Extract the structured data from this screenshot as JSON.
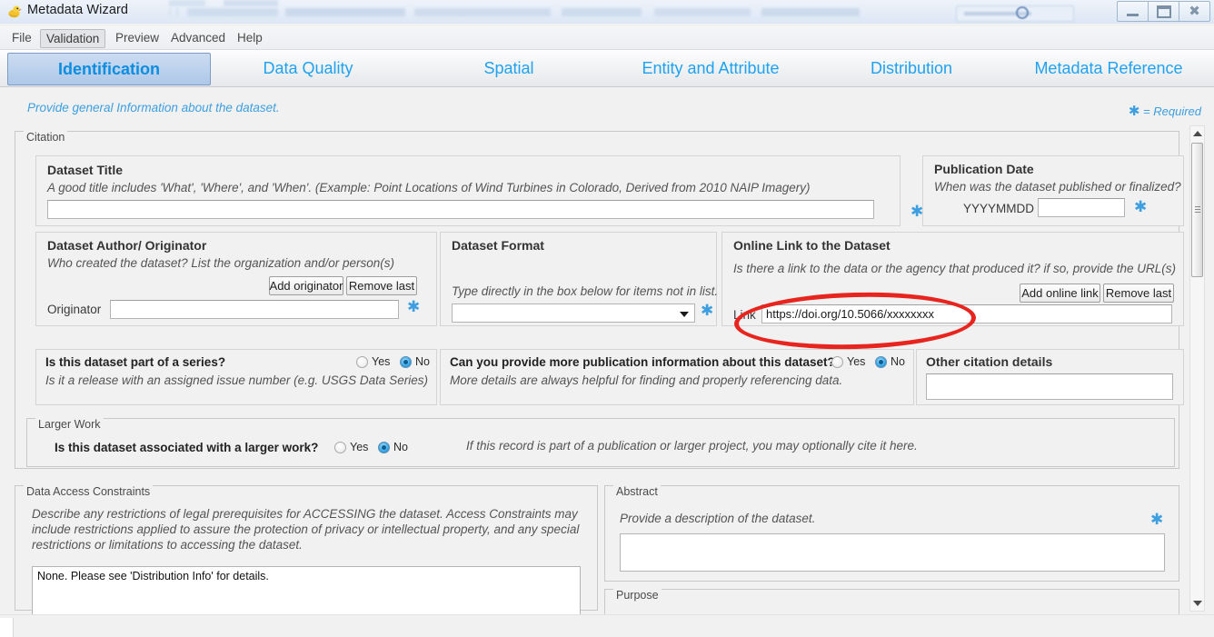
{
  "window": {
    "title": "Metadata Wizard",
    "app_icon": "duck-icon",
    "controls": {
      "minimize": "minimize-icon",
      "maximize": "maximize-icon",
      "close": "close-icon"
    }
  },
  "menubar": {
    "items": [
      {
        "label": "File",
        "selected": false
      },
      {
        "label": "Validation",
        "selected": true
      },
      {
        "label": "Preview",
        "selected": false
      },
      {
        "label": "Advanced",
        "selected": false
      },
      {
        "label": "Help",
        "selected": false
      }
    ]
  },
  "tabs": [
    {
      "label": "Identification",
      "active": true
    },
    {
      "label": "Data Quality",
      "active": false
    },
    {
      "label": "Spatial",
      "active": false
    },
    {
      "label": "Entity and Attribute",
      "active": false
    },
    {
      "label": "Distribution",
      "active": false
    },
    {
      "label": "Metadata Reference",
      "active": false
    }
  ],
  "page": {
    "hint": "Provide general Information about the dataset.",
    "required_legend": "= Required",
    "required_marker": "✱"
  },
  "citation": {
    "group_title": "Citation",
    "dataset_title": {
      "title": "Dataset Title",
      "hint": "A good title includes 'What', 'Where', and 'When'.  (Example: Point Locations of Wind Turbines in Colorado, Derived from 2010 NAIP Imagery)",
      "value": "",
      "required": true
    },
    "publication_date": {
      "title": "Publication Date",
      "hint": "When was the dataset published or finalized?",
      "format_label": "YYYYMMDD",
      "value": "",
      "required": true
    },
    "author": {
      "title": "Dataset Author/ Originator",
      "hint": "Who created the dataset? List the organization and/or person(s)",
      "add_button": "Add originator",
      "remove_button": "Remove last",
      "field_label": "Originator",
      "value": "",
      "required": true
    },
    "format": {
      "title": "Dataset Format",
      "hint": "Type directly in the box below for items not in list.",
      "value": "",
      "required": true
    },
    "online_link": {
      "title": "Online Link to the Dataset",
      "hint": "Is there a link to the data or the agency that produced it? if so, provide the URL(s)",
      "add_button": "Add online link",
      "remove_button": "Remove last",
      "field_label": "Link",
      "value": "https://doi.org/10.5066/xxxxxxxx"
    },
    "series": {
      "question": "Is this dataset part of a series?",
      "hint": "Is it a release with an assigned issue number (e.g. USGS Data Series)",
      "yes_label": "Yes",
      "no_label": "No",
      "selected": "No"
    },
    "more_publication": {
      "question": "Can you provide more publication information about this dataset?",
      "hint": "More details are always helpful for finding and properly referencing data.",
      "yes_label": "Yes",
      "no_label": "No",
      "selected": "No"
    },
    "other_details": {
      "title": "Other citation details",
      "value": ""
    },
    "larger_work": {
      "group_title": "Larger Work",
      "question": "Is this dataset associated with a larger work?",
      "yes_label": "Yes",
      "no_label": "No",
      "selected": "No",
      "hint": "If this record is part of a publication or larger project, you may optionally cite it here."
    }
  },
  "access_constraints": {
    "group_title": "Data Access Constraints",
    "hint": "Describe any restrictions of legal prerequisites for ACCESSING the dataset.  Access Constraints may include restrictions applied to assure the protection of privacy or intellectual property, and any special restrictions or limitations to accessing the dataset.",
    "value": "None.  Please see 'Distribution Info' for details."
  },
  "abstract": {
    "group_title": "Abstract",
    "hint": "Provide a description of the dataset.",
    "value": "",
    "required": true
  },
  "purpose": {
    "group_title": "Purpose"
  },
  "scrollbar": {
    "up_icon": "chevron-up-icon",
    "down_icon": "chevron-down-icon"
  },
  "annotation": {
    "shape": "ellipse",
    "color": "#e8241e",
    "target": "online-link-field"
  }
}
